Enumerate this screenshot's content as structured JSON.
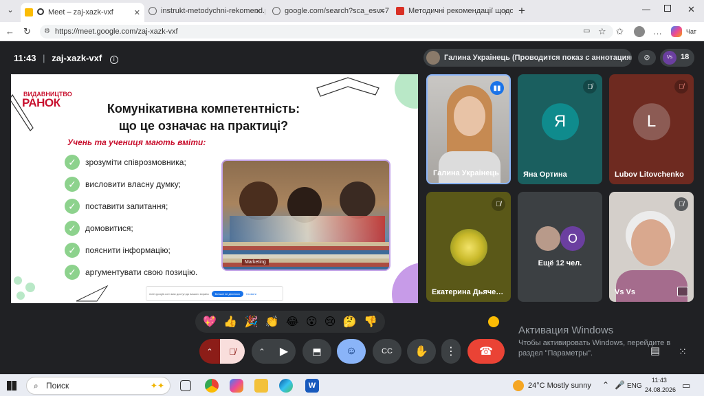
{
  "tabs": [
    {
      "title": "Meet – zaj-xazk-vxf",
      "active": true
    },
    {
      "title": "instrukt-metodychni-rekomend.p",
      "active": false
    },
    {
      "title": "google.com/search?sca_esv=7e6",
      "active": false
    },
    {
      "title": "Методичні рекомендації щодо в",
      "active": false
    }
  ],
  "address": {
    "url": "https://meet.google.com/zaj-xazk-vxf",
    "chat_label": "Чат"
  },
  "meet": {
    "time": "11:43",
    "meeting_code": "zaj-xazk-vxf",
    "presenter": "Галина Украінець (Проводится показ с аннотациями.)",
    "participant_count": "18",
    "mini_avatar_label": "Vs"
  },
  "slide": {
    "logo_top": "ВИДАВНИЦТВО",
    "logo_main": "РАНОК",
    "title_line1": "Комунікативна компетентність:",
    "title_line2": "що це означає на практиці?",
    "subtitle": "Учень та учениця мають вміти:",
    "items": [
      "зрозуміти співрозмовника;",
      "висловити власну думку;",
      "поставити запитання;",
      "домовитися;",
      "пояснити інформацію;",
      "аргументувати свою позицію."
    ],
    "book_label": "Marketing",
    "notice_text": "meet.google.com має доступ до вашого екрана",
    "notice_button": "Більше не ділитися",
    "notice_hide": "Сховати"
  },
  "tiles": [
    {
      "name": "Галина Украінець",
      "type": "video",
      "color": "#b5b3b0"
    },
    {
      "name": "Яна Ортина",
      "type": "letter",
      "letter": "Я",
      "color": "#1a6b6b",
      "avatar_color": "#0f8b8d"
    },
    {
      "name": "Lubov Litovchenko",
      "type": "letter",
      "letter": "L",
      "color": "#7a2e22",
      "avatar_color": "#8c5b54"
    },
    {
      "name": "Екатерина Дьяченко",
      "type": "image",
      "color": "#5c5a1a"
    },
    {
      "name": "Ещё 12 чел.",
      "type": "more",
      "letter": "О",
      "color": "#3c4043",
      "avatar_color": "#6b3fa0"
    },
    {
      "name": "Vs Vs",
      "type": "video",
      "color": "#c7c2bd"
    }
  ],
  "reactions": [
    "💖",
    "👍",
    "🎉",
    "👏",
    "😂",
    "😮",
    "😢",
    "🤔",
    "👎"
  ],
  "windows_activation": {
    "title": "Активация Windows",
    "text": "Чтобы активировать Windows, перейдите в раздел \"Параметры\"."
  },
  "taskbar": {
    "search_placeholder": "Поиск",
    "weather": "24°C  Mostly sunny",
    "lang": "ENG",
    "time": "11:43",
    "date": "24.08.2026"
  }
}
